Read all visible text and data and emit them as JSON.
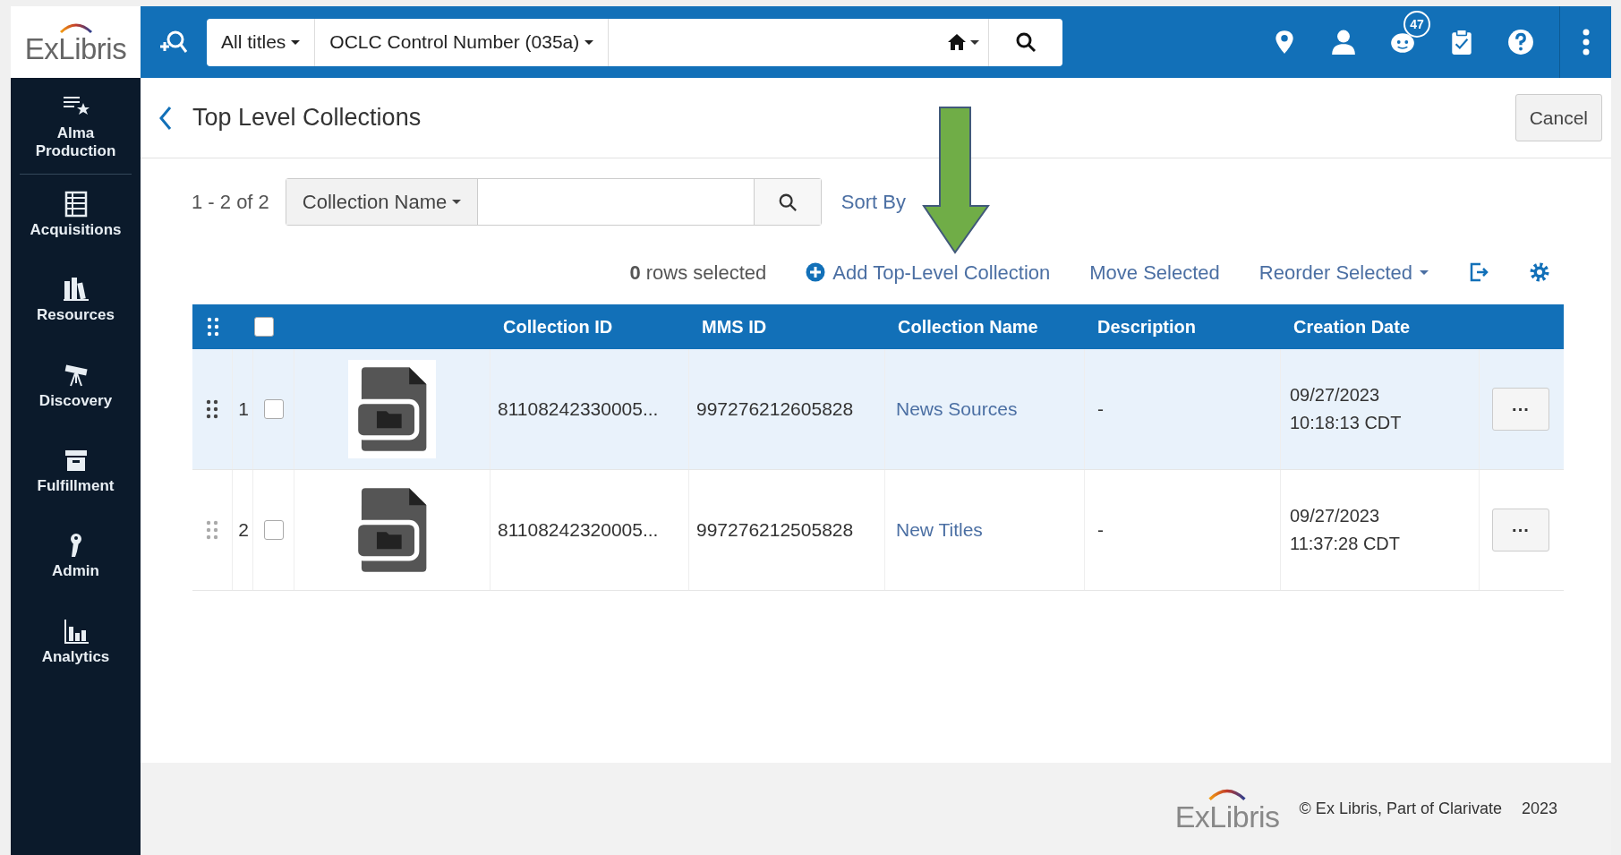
{
  "logo": {
    "text": "ExLibris"
  },
  "search_bar": {
    "scope": "All titles",
    "field": "OCLC Control Number (035a)"
  },
  "notifications_badge": "47",
  "sidebar": {
    "items": [
      {
        "label": "Alma Production",
        "kind": "production"
      },
      {
        "label": "Acquisitions",
        "kind": "acquisitions"
      },
      {
        "label": "Resources",
        "kind": "resources"
      },
      {
        "label": "Discovery",
        "kind": "discovery"
      },
      {
        "label": "Fulfillment",
        "kind": "fulfillment"
      },
      {
        "label": "Admin",
        "kind": "admin"
      },
      {
        "label": "Analytics",
        "kind": "analytics"
      }
    ]
  },
  "page": {
    "title": "Top Level Collections",
    "cancel_button": "Cancel"
  },
  "toolbar": {
    "count": "1 - 2 of 2",
    "filter": "Collection Name",
    "sort": "Sort By"
  },
  "actions": {
    "selected_count": "0",
    "selected_label": "rows selected",
    "add": "Add Top-Level Collection",
    "move": "Move Selected",
    "reorder": "Reorder Selected"
  },
  "table": {
    "header_checked": false,
    "columns": [
      "Collection ID",
      "MMS ID",
      "Collection Name",
      "Description",
      "Creation Date"
    ],
    "rows": [
      {
        "number": "1",
        "checked": false,
        "selected": true,
        "collection_id": "81108242330005...",
        "mms_id": "997276212605828",
        "name": "News Sources",
        "description": "-",
        "date": "09/27/2023",
        "time": "10:18:13 CDT",
        "menu": "···"
      },
      {
        "number": "2",
        "checked": false,
        "selected": false,
        "collection_id": "81108242320005...",
        "mms_id": "997276212505828",
        "name": "New Titles",
        "description": "-",
        "date": "09/27/2023",
        "time": "11:37:28 CDT",
        "menu": "···"
      }
    ]
  },
  "footer": {
    "logo": "ExLibris",
    "copyright": "© Ex Libris, Part of Clarivate",
    "year": "2023"
  }
}
